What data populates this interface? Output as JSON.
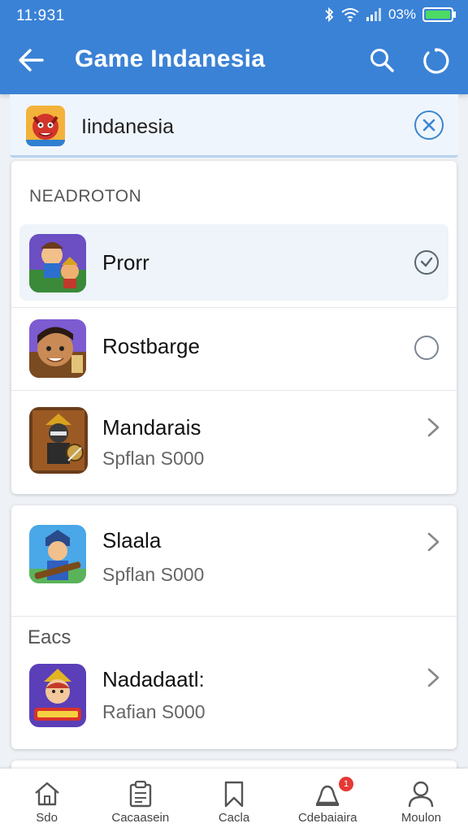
{
  "status_bar": {
    "time": "11:931",
    "battery_text": "03%",
    "icons": [
      "bluetooth-icon",
      "wifi-icon",
      "signal-icon",
      "battery-icon"
    ]
  },
  "toolbar": {
    "title": "Game Indanesia",
    "back_icon": "back-arrow-icon",
    "search_icon": "search-icon",
    "more_icon": "loading-circle-icon",
    "color": "#3a82d6"
  },
  "search": {
    "value": "Iindanesia",
    "thumbnail_icon": "red-dragon-game-icon",
    "clear_icon": "close-circle-icon",
    "accent": "#3a86d2"
  },
  "card1": {
    "section_header": "NEADROTON",
    "items": [
      {
        "title": "Prorr",
        "control": "radio-checked",
        "icon": "heroes-game-icon",
        "selected": true
      },
      {
        "title": "Rostbarge",
        "control": "radio",
        "icon": "boy-game-icon",
        "selected": false
      },
      {
        "title": "Mandarais",
        "subtitle": "Spflan S000",
        "control": "chevron",
        "icon": "knight-game-icon"
      }
    ]
  },
  "card2": {
    "items": [
      {
        "title": "Slaala",
        "subtitle": "Spflan S000",
        "control": "chevron",
        "icon": "warrior-game-icon"
      }
    ],
    "section_header": "Eacs",
    "items2": [
      {
        "title": "Nadadaatl:",
        "subtitle": "Rafian S000",
        "control": "chevron",
        "icon": "princess-game-icon"
      }
    ]
  },
  "bottom_nav": {
    "items": [
      {
        "label": "Sdo",
        "icon": "home-icon"
      },
      {
        "label": "Cacaasein",
        "icon": "clipboard-icon"
      },
      {
        "label": "Cacla",
        "icon": "bookmark-icon"
      },
      {
        "label": "Cdebaiaira",
        "icon": "notification-icon",
        "badge": "1"
      },
      {
        "label": "Moulon",
        "icon": "profile-icon"
      }
    ]
  }
}
